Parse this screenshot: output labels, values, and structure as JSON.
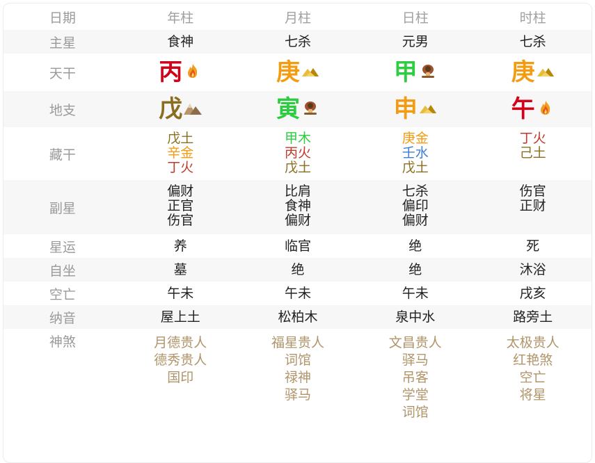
{
  "labels": {
    "date": "日期",
    "main_star": "主星",
    "tiangan": "天干",
    "dizhi": "地支",
    "canggan": "藏干",
    "fuxing": "副星",
    "xingyun": "星运",
    "zizuo": "自坐",
    "kongwang": "空亡",
    "nayin": "纳音",
    "shensha": "神煞"
  },
  "pillars": [
    "年柱",
    "月柱",
    "日柱",
    "时柱"
  ],
  "main_star": [
    "食神",
    "七杀",
    "元男",
    "七杀"
  ],
  "tiangan": [
    {
      "char": "丙",
      "color": "#d0021b",
      "icon": "fire-icon"
    },
    {
      "char": "庚",
      "color": "#f39c12",
      "icon": "gold-ingot-icon"
    },
    {
      "char": "甲",
      "color": "#2ecc40",
      "icon": "tree-icon"
    },
    {
      "char": "庚",
      "color": "#f39c12",
      "icon": "gold-ingot-icon"
    }
  ],
  "dizhi": [
    {
      "char": "戊",
      "color": "#8b6d1e",
      "icon": "mountain-icon"
    },
    {
      "char": "寅",
      "color": "#2ecc40",
      "icon": "tree-icon"
    },
    {
      "char": "申",
      "color": "#f39c12",
      "icon": "gold-ingot-icon"
    },
    {
      "char": "午",
      "color": "#d0021b",
      "icon": "fire-icon"
    }
  ],
  "canggan": [
    [
      {
        "text": "戊土",
        "color": "#8b6d1e"
      },
      {
        "text": "辛金",
        "color": "#f39c12"
      },
      {
        "text": "丁火",
        "color": "#c0392b"
      }
    ],
    [
      {
        "text": "甲木",
        "color": "#2ecc40"
      },
      {
        "text": "丙火",
        "color": "#c0392b"
      },
      {
        "text": "戊土",
        "color": "#8b6d1e"
      }
    ],
    [
      {
        "text": "庚金",
        "color": "#f39c12"
      },
      {
        "text": "壬水",
        "color": "#3b7dd8"
      },
      {
        "text": "戊土",
        "color": "#8b6d1e"
      }
    ],
    [
      {
        "text": "丁火",
        "color": "#c0392b"
      },
      {
        "text": "己土",
        "color": "#8b6d1e"
      }
    ]
  ],
  "fuxing": [
    [
      "偏财",
      "正官",
      "伤官"
    ],
    [
      "比肩",
      "食神",
      "偏财"
    ],
    [
      "七杀",
      "偏印",
      "偏财"
    ],
    [
      "伤官",
      "正财"
    ]
  ],
  "xingyun": [
    "养",
    "临官",
    "绝",
    "死"
  ],
  "zizuo": [
    "墓",
    "绝",
    "绝",
    "沐浴"
  ],
  "kongwang": [
    "午未",
    "午未",
    "午未",
    "戌亥"
  ],
  "nayin": [
    "屋上土",
    "松柏木",
    "泉中水",
    "路旁土"
  ],
  "shensha": [
    [
      "月德贵人",
      "德秀贵人",
      "国印"
    ],
    [
      "福星贵人",
      "词馆",
      "禄神",
      "驿马"
    ],
    [
      "文昌贵人",
      "驿马",
      "吊客",
      "学堂",
      "词馆"
    ],
    [
      "太极贵人",
      "红艳煞",
      "空亡",
      "将星"
    ]
  ]
}
